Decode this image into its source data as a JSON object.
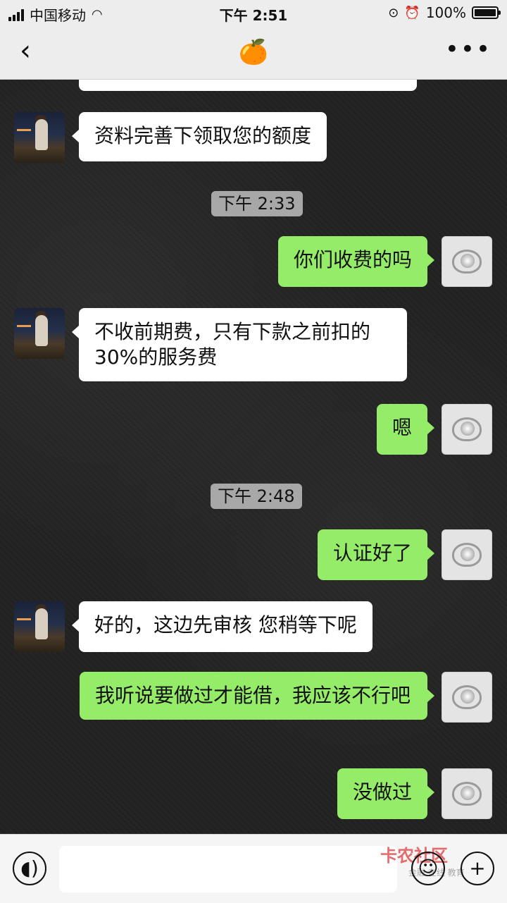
{
  "status_bar": {
    "carrier": "中国移动",
    "time": "下午 2:51",
    "battery": "100%",
    "battery_level": 1.0
  },
  "header": {
    "back_icon": "chevron-left-icon",
    "title_emoji": "🍊",
    "more_icon": "ellipsis-icon"
  },
  "messages": [
    {
      "side": "in",
      "text": "资料完善下领取您的额度"
    },
    {
      "timestamp": "下午 2:33"
    },
    {
      "side": "out",
      "text": "你们收费的吗"
    },
    {
      "side": "in",
      "text": "不收前期费，只有下款之前扣的30%的服务费"
    },
    {
      "side": "out",
      "text": "嗯"
    },
    {
      "timestamp": "下午 2:48"
    },
    {
      "side": "out",
      "text": "认证好了"
    },
    {
      "side": "in",
      "text": "好的，这边先审核 您稍等下呢"
    },
    {
      "side": "out",
      "text": "我听说要做过才能借，我应该不行吧"
    },
    {
      "side": "out",
      "text": "没做过"
    }
  ],
  "input_bar": {
    "voice_icon": "voice-icon",
    "emoji_icon": "emoji-icon",
    "add_icon": "plus-icon",
    "watermark": "卡农社区",
    "watermark_sub": "金融 在线 教育"
  },
  "colors": {
    "outgoing_bubble": "#95ec69",
    "incoming_bubble": "#ffffff",
    "bar_background": "#ededed"
  }
}
